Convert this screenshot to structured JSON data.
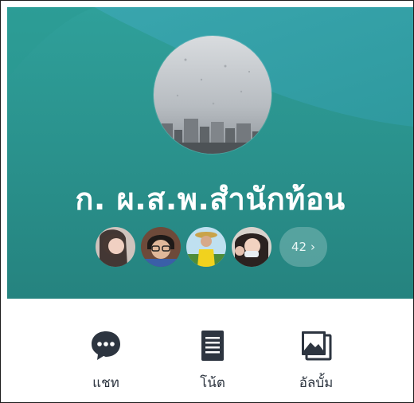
{
  "group": {
    "name": "ก. ผ.ส.พ.สำนักท้อน",
    "member_count": "42",
    "member_count_chevron": "›"
  },
  "members": [
    {
      "name": "member-1"
    },
    {
      "name": "member-2"
    },
    {
      "name": "member-3"
    },
    {
      "name": "member-4"
    }
  ],
  "actions": {
    "chat": {
      "label": "แชท",
      "icon": "chat-bubble-icon"
    },
    "note": {
      "label": "โน้ต",
      "icon": "note-document-icon"
    },
    "album": {
      "label": "อัลบั้ม",
      "icon": "photo-album-icon"
    }
  },
  "colors": {
    "cover_base": "#2b8f8d",
    "cover_light": "#35a7a3",
    "icon_dark": "#2d3540",
    "text_white": "#ffffff"
  }
}
